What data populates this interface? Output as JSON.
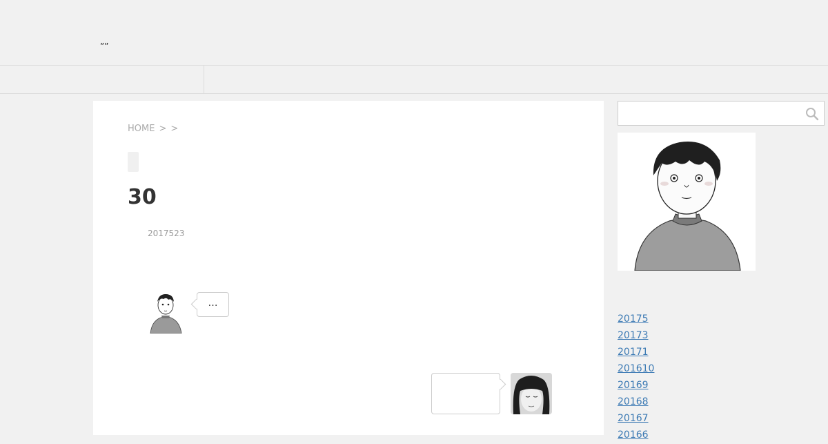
{
  "header": {
    "site_title": "””"
  },
  "breadcrumb": {
    "home": "HOME",
    "sep1": ">",
    "sep2": ">"
  },
  "post": {
    "title": "30",
    "date": "2017523"
  },
  "dialogue": {
    "left_bubble_text": "…",
    "right_bubble_text": ""
  },
  "search": {
    "placeholder": "",
    "icon": "search-icon"
  },
  "sidebar": {
    "archives": [
      "20175",
      "20173",
      "20171",
      "201610",
      "20169",
      "20168",
      "20167",
      "20166"
    ]
  },
  "colors": {
    "background": "#f1f1f1",
    "content": "#ffffff",
    "link": "#3c7ab4",
    "muted": "#aaaaaa"
  }
}
